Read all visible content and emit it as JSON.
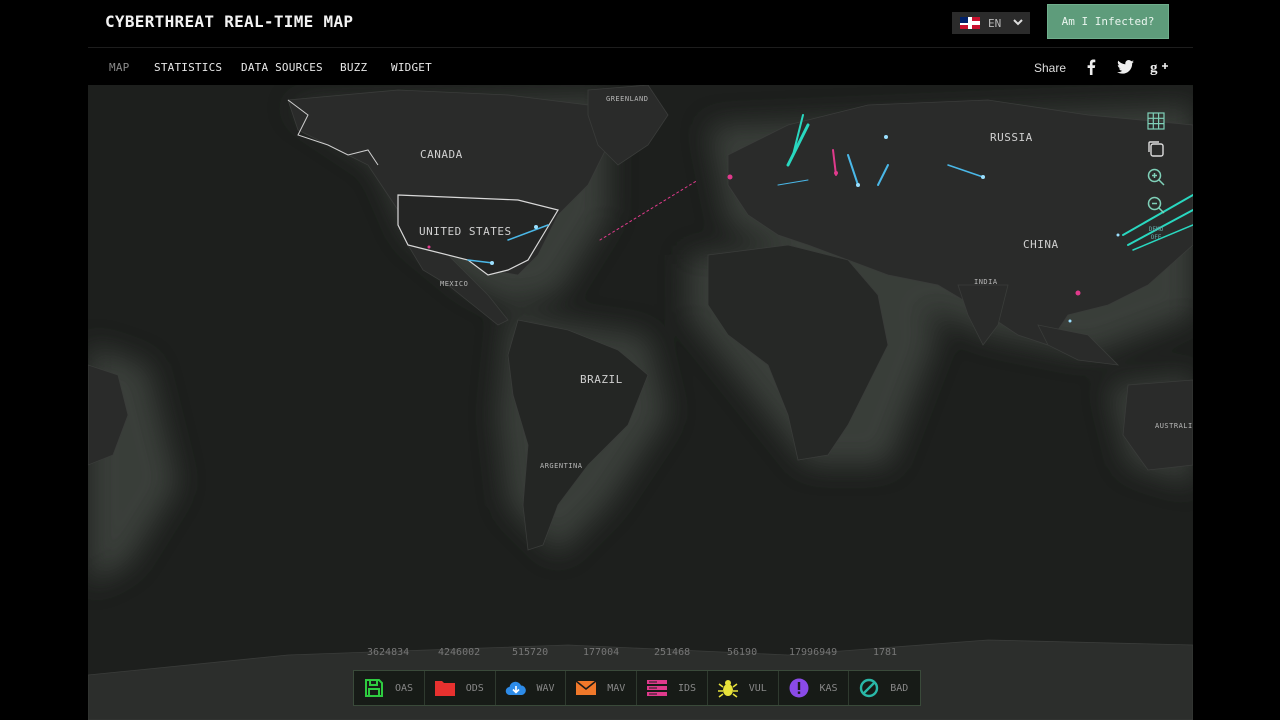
{
  "header": {
    "title": "CYBERTHREAT REAL-TIME MAP",
    "language": "EN",
    "infected_button": "Am I Infected?"
  },
  "nav": {
    "items": [
      {
        "label": "MAP",
        "active": true
      },
      {
        "label": "STATISTICS",
        "active": false
      },
      {
        "label": "DATA SOURCES",
        "active": false
      },
      {
        "label": "BUZZ",
        "active": false
      },
      {
        "label": "WIDGET",
        "active": false
      }
    ],
    "share_label": "Share",
    "social_icons": [
      "facebook-icon",
      "twitter-icon",
      "google-plus-icon"
    ]
  },
  "map": {
    "labels": {
      "greenland": "GREENLAND",
      "canada": "CANADA",
      "united_states": "UNITED STATES",
      "mexico": "MEXICO",
      "brazil": "BRAZIL",
      "argentina": "ARGENTINA",
      "russia": "RUSSIA",
      "china": "CHINA",
      "india": "INDIA",
      "australia": "AUSTRALI"
    },
    "controls": [
      "grid-icon",
      "layers-icon",
      "zoom-in-icon",
      "zoom-out-icon"
    ],
    "demo_toggle": {
      "line1": "DEMO",
      "line2": "OFF"
    }
  },
  "stats": {
    "counts": [
      "3624834",
      "4246002",
      "515720",
      "177004",
      "251468",
      "56190",
      "17996949",
      "1781"
    ],
    "items": [
      {
        "label": "OAS",
        "icon": "floppy-disk-icon",
        "color": "#2ecc40"
      },
      {
        "label": "ODS",
        "icon": "folder-icon",
        "color": "#e8312f"
      },
      {
        "label": "WAV",
        "icon": "cloud-download-icon",
        "color": "#2d8be8"
      },
      {
        "label": "MAV",
        "icon": "envelope-icon",
        "color": "#f0782a"
      },
      {
        "label": "IDS",
        "icon": "server-icon",
        "color": "#e03a8c"
      },
      {
        "label": "VUL",
        "icon": "bug-icon",
        "color": "#e8e33a"
      },
      {
        "label": "KAS",
        "icon": "exclamation-icon",
        "color": "#8a4ae8"
      },
      {
        "label": "BAD",
        "icon": "block-icon",
        "color": "#29b8a8"
      }
    ]
  }
}
